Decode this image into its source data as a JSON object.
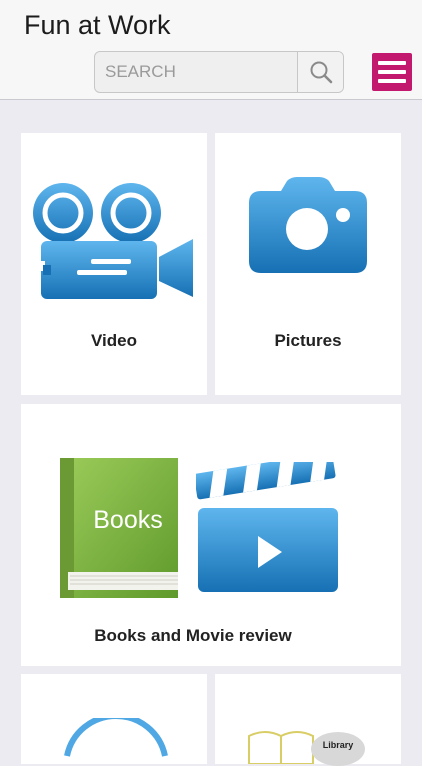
{
  "header": {
    "title": "Fun at Work",
    "search": {
      "placeholder": "SEARCH",
      "value": ""
    },
    "search_icon": "search-icon",
    "menu_icon": "hamburger-menu-icon"
  },
  "tiles": [
    {
      "label": "Video",
      "icon": "video-camera-icon"
    },
    {
      "label": "Pictures",
      "icon": "camera-icon"
    },
    {
      "label": "Books and Movie review",
      "icons": [
        "books-icon",
        "clapperboard-icon"
      ]
    },
    {
      "label": "",
      "icon": "circle-icon"
    },
    {
      "label": "",
      "icon": "library-icon",
      "badge": "Library"
    }
  ],
  "colors": {
    "accent": "#c2186e",
    "icon_blue": "#1f86c8",
    "book_green": "#7cb342",
    "background": "#ecebf2"
  }
}
